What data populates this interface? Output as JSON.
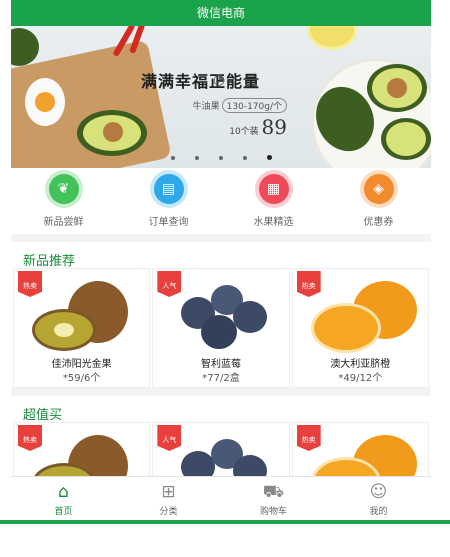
{
  "app": {
    "title": "微信电商"
  },
  "banner": {
    "headline": "满满幸福正能量",
    "product": "牛油果",
    "spec": "130-170g/个",
    "unit_prefix": "10个装",
    "price": "89",
    "dots": 5,
    "active_dot": 4
  },
  "quick_nav": [
    {
      "label": "新品尝鲜",
      "icon": "leaf-icon",
      "color": "#44c25a"
    },
    {
      "label": "订单查询",
      "icon": "document-icon",
      "color": "#2ea8e8"
    },
    {
      "label": "水果精选",
      "icon": "basket-icon",
      "color": "#ef4a5a"
    },
    {
      "label": "优惠券",
      "icon": "coupon-icon",
      "color": "#f28a2e"
    }
  ],
  "sections": [
    {
      "title": "新品推荐",
      "products": [
        {
          "badge": "热卖",
          "name": "佳沛阳光金果",
          "price": "*59/6个",
          "fruit": "kiwi"
        },
        {
          "badge": "人气",
          "name": "智利蓝莓",
          "price": "*77/2盒",
          "fruit": "blueberry"
        },
        {
          "badge": "热卖",
          "name": "澳大利亚脐橙",
          "price": "*49/12个",
          "fruit": "orange"
        }
      ]
    },
    {
      "title": "超值买",
      "products": [
        {
          "badge": "热卖",
          "name": "",
          "price": "",
          "fruit": "kiwi"
        },
        {
          "badge": "人气",
          "name": "",
          "price": "",
          "fruit": "blueberry"
        },
        {
          "badge": "热卖",
          "name": "",
          "price": "",
          "fruit": "orange"
        }
      ]
    }
  ],
  "tabbar": [
    {
      "label": "首页",
      "icon": "home-icon",
      "active": true
    },
    {
      "label": "分类",
      "icon": "grid-icon",
      "active": false
    },
    {
      "label": "购物车",
      "icon": "cart-icon",
      "active": false
    },
    {
      "label": "我的",
      "icon": "user-icon",
      "active": false
    }
  ],
  "colors": {
    "brand": "#1aa34a",
    "section_title": "#1a8a3a",
    "badge": "#e8403d"
  }
}
